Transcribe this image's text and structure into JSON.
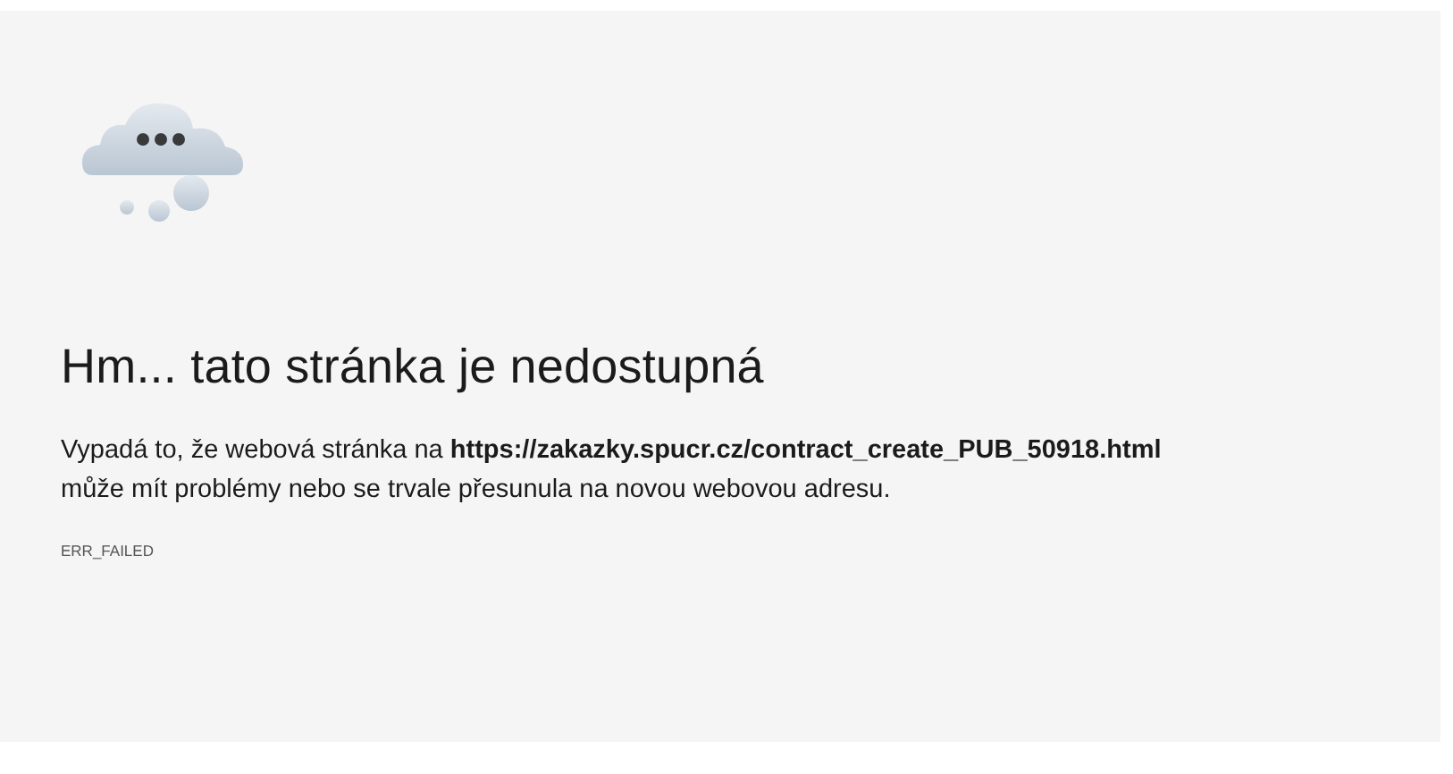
{
  "error_page": {
    "heading": "Hm... tato stránka je nedostupná",
    "message": "Vypadá to, že webová stránka na **https://zakazky.spucr.cz/contract_create_PUB_50918.html**\nmůže mít problémy nebo se trvale přesunula na novou webovou adresu.",
    "error_code": "ERR_FAILED"
  }
}
